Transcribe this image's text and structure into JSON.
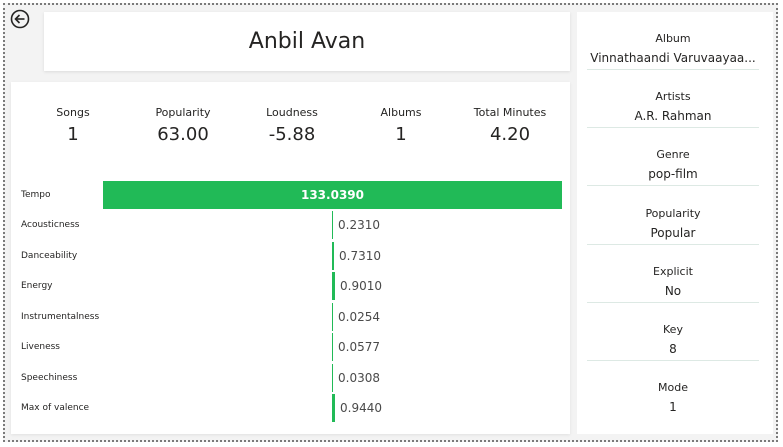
{
  "title": "Anbil Avan",
  "kpis": [
    {
      "label": "Songs",
      "value": "1"
    },
    {
      "label": "Popularity",
      "value": "63.00"
    },
    {
      "label": "Loudness",
      "value": "-5.88"
    },
    {
      "label": "Albums",
      "value": "1"
    },
    {
      "label": "Total Minutes",
      "value": "4.20"
    }
  ],
  "features": [
    {
      "label": "Tempo",
      "value": "133.0390",
      "fill": 1.0
    },
    {
      "label": "Acousticness",
      "value": "0.2310",
      "fill": 0.231
    },
    {
      "label": "Danceability",
      "value": "0.7310",
      "fill": 0.731
    },
    {
      "label": "Energy",
      "value": "0.9010",
      "fill": 0.901
    },
    {
      "label": "Instrumentalness",
      "value": "0.0254",
      "fill": 0.0254
    },
    {
      "label": "Liveness",
      "value": "0.0577",
      "fill": 0.0577
    },
    {
      "label": "Speechiness",
      "value": "0.0308",
      "fill": 0.0308
    },
    {
      "label": "Max of valence",
      "value": "0.9440",
      "fill": 0.944
    }
  ],
  "details": [
    {
      "label": "Album",
      "value": "Vinnathaandi Varuvaayaa..."
    },
    {
      "label": "Artists",
      "value": "A.R. Rahman"
    },
    {
      "label": "Genre",
      "value": "pop-film"
    },
    {
      "label": "Popularity",
      "value": "Popular"
    },
    {
      "label": "Explicit",
      "value": "No"
    },
    {
      "label": "Key",
      "value": "8"
    },
    {
      "label": "Mode",
      "value": "1"
    }
  ],
  "colors": {
    "accent": "#21ba57"
  },
  "icons": {
    "back": "back-arrow-icon",
    "more": "more-options-icon"
  }
}
